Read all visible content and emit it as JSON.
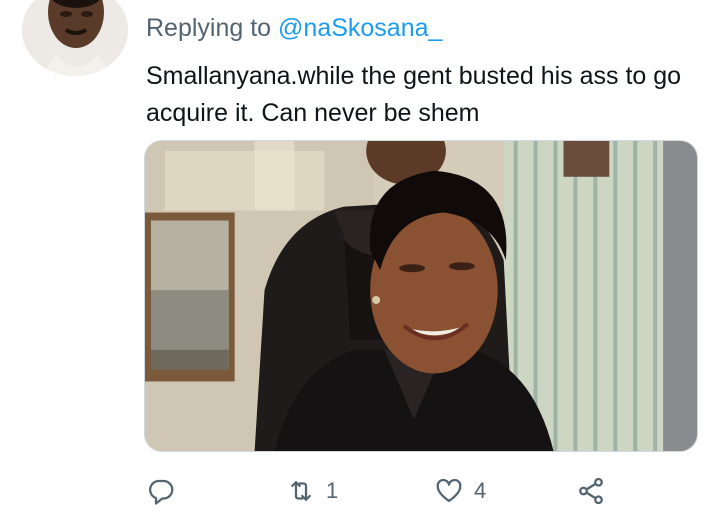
{
  "reply_context": {
    "prefix": "Replying to",
    "handle": "@naSkosana_"
  },
  "tweet": {
    "text": "Smallanyana.while the gent busted his ass to go acquire it. Can never be shem"
  },
  "media": {
    "kind": "photo"
  },
  "actions": {
    "reply_count": "",
    "retweet_count": "1",
    "like_count": "4",
    "icon_color": "#536471"
  },
  "colors": {
    "link": "#1d9bf0",
    "secondary_text": "#536471",
    "primary_text": "#0f1419"
  }
}
